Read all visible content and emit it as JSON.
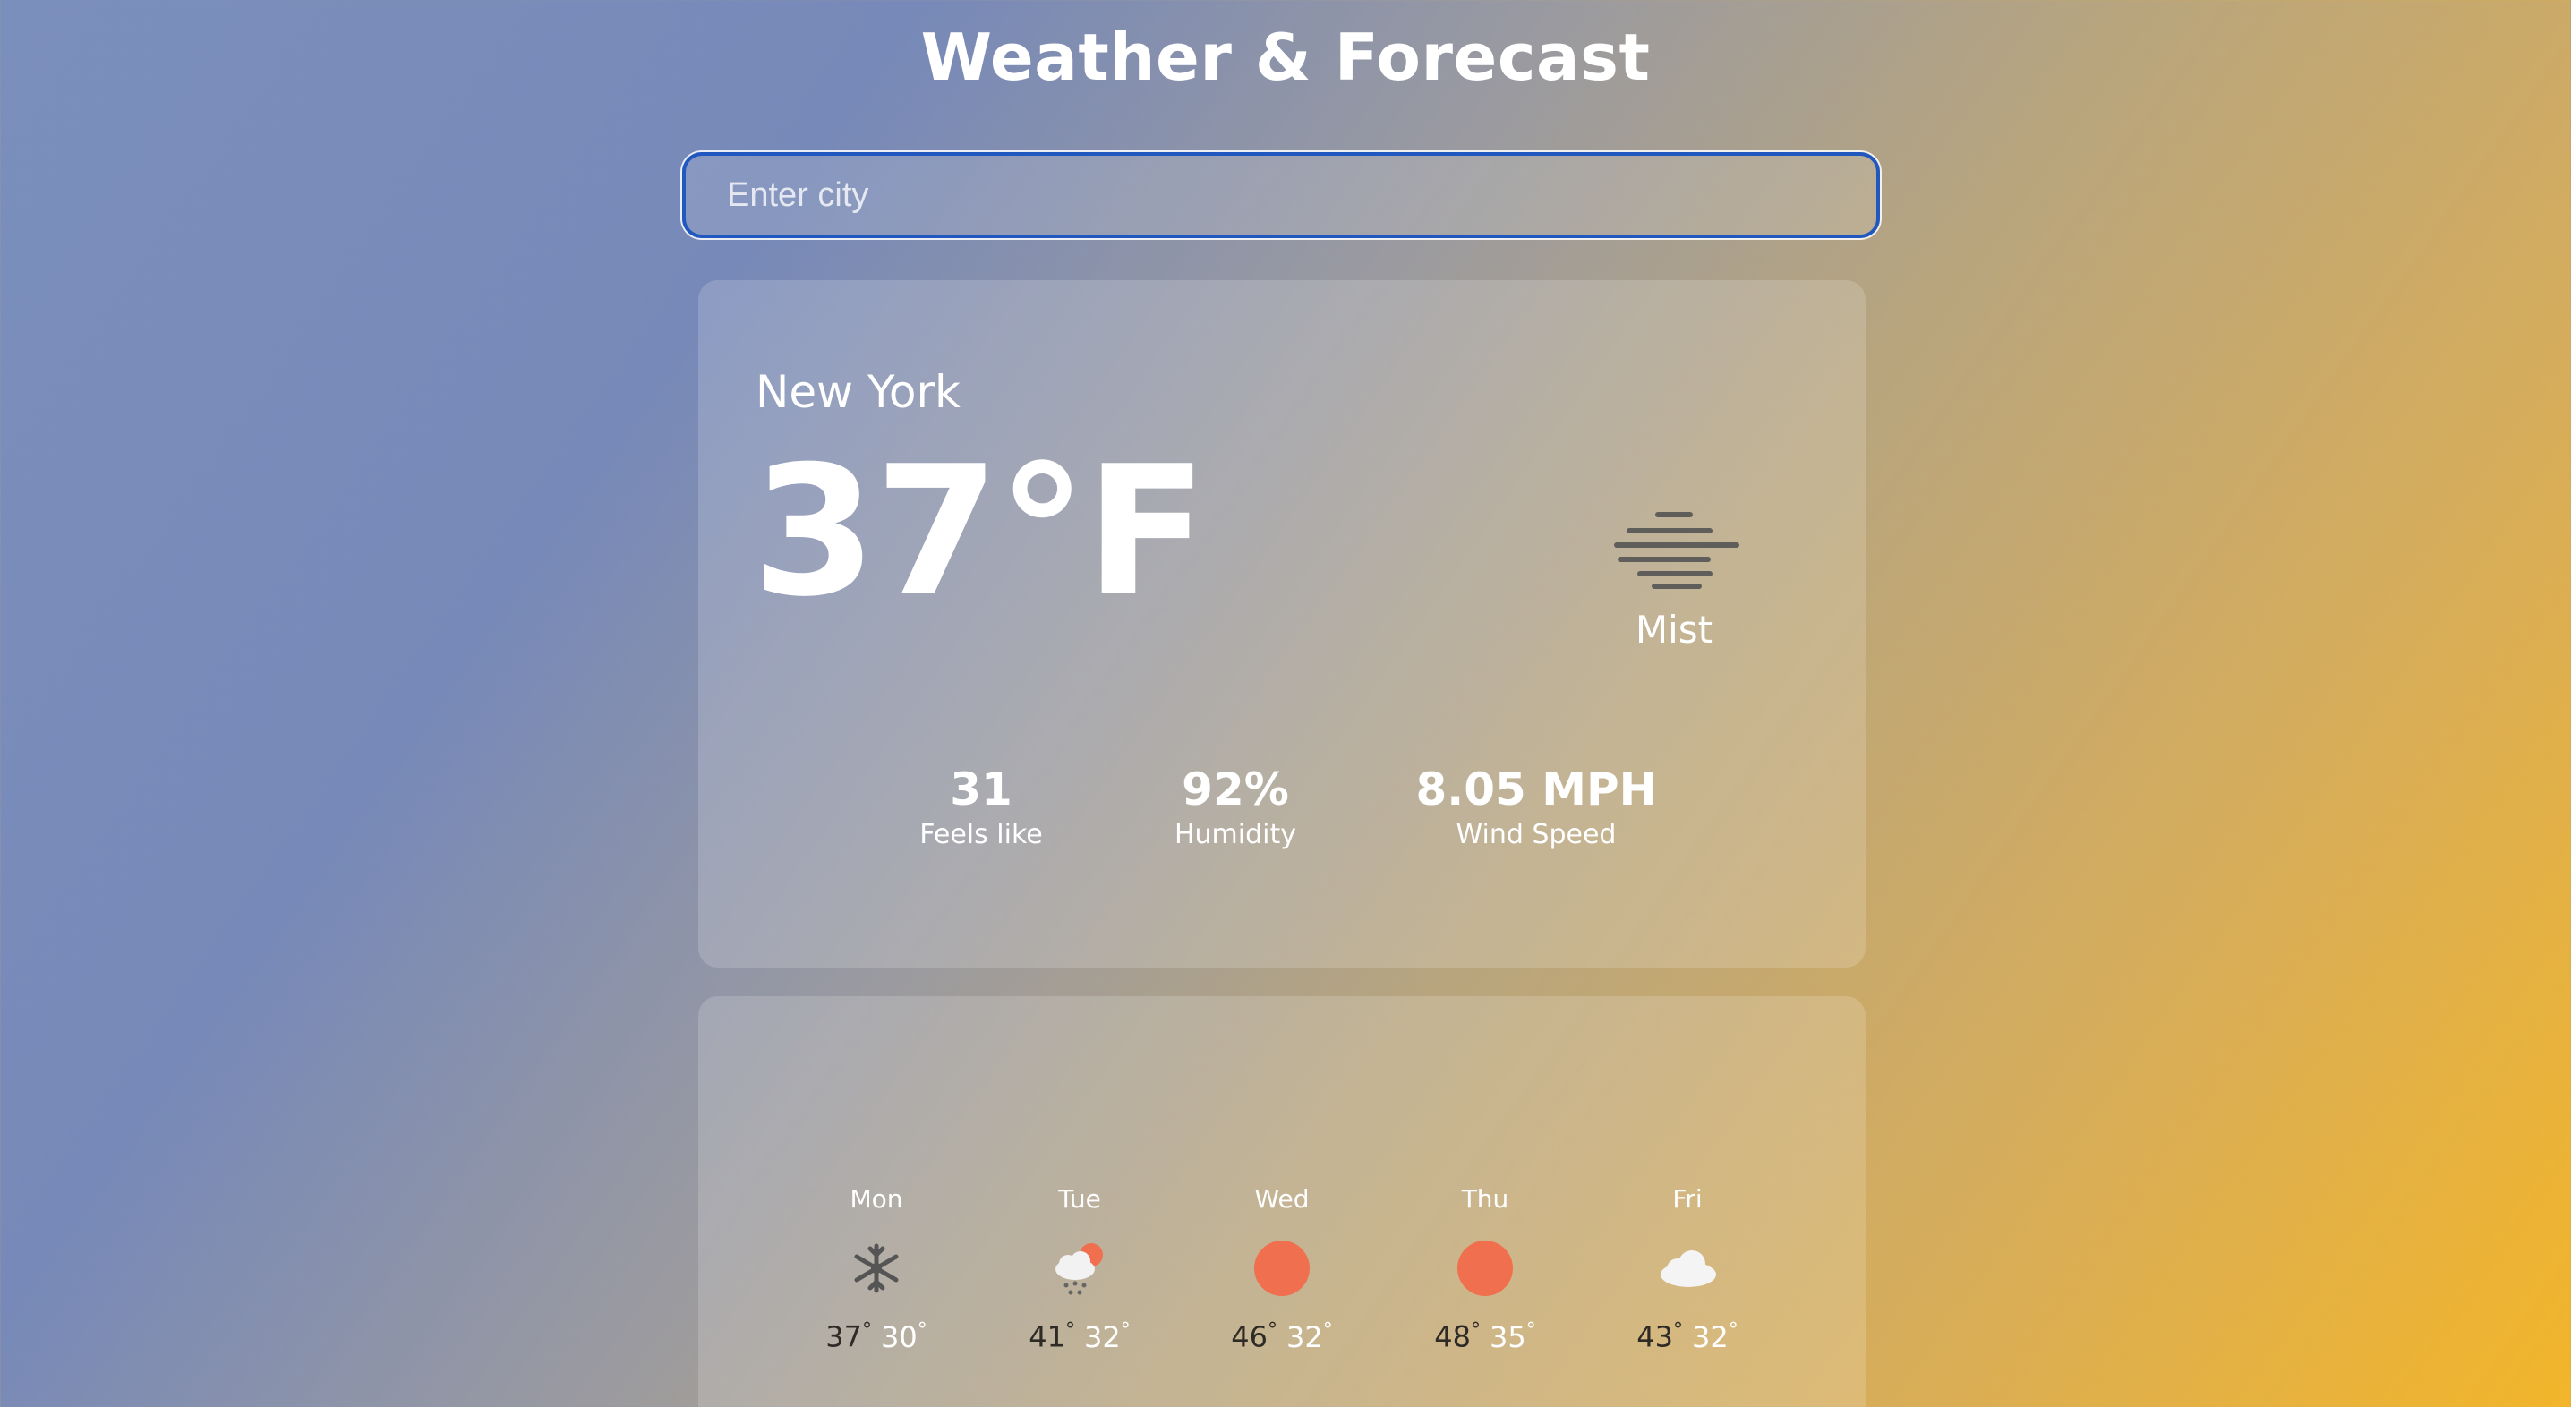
{
  "header": {
    "title": "Weather & Forecast"
  },
  "search": {
    "placeholder": "Enter city",
    "value": ""
  },
  "current": {
    "city": "New York",
    "temperature": "37°F",
    "condition": "Mist",
    "condition_icon": "mist-icon",
    "stats": [
      {
        "value": "31",
        "label": "Feels like"
      },
      {
        "value": "92%",
        "label": "Humidity"
      },
      {
        "value": "8.05 MPH",
        "label": "Wind Speed"
      }
    ]
  },
  "forecast": [
    {
      "day": "Mon",
      "icon": "snowflake-icon",
      "high": "37",
      "low": "30"
    },
    {
      "day": "Tue",
      "icon": "rain-sun-icon",
      "high": "41",
      "low": "32"
    },
    {
      "day": "Wed",
      "icon": "sun-icon",
      "high": "46",
      "low": "32"
    },
    {
      "day": "Thu",
      "icon": "sun-icon",
      "high": "48",
      "low": "35"
    },
    {
      "day": "Fri",
      "icon": "cloud-icon",
      "high": "43",
      "low": "32"
    }
  ],
  "colors": {
    "sun": "#ef6f4f",
    "icon_dark": "#555555",
    "search_border": "#2058c0"
  }
}
